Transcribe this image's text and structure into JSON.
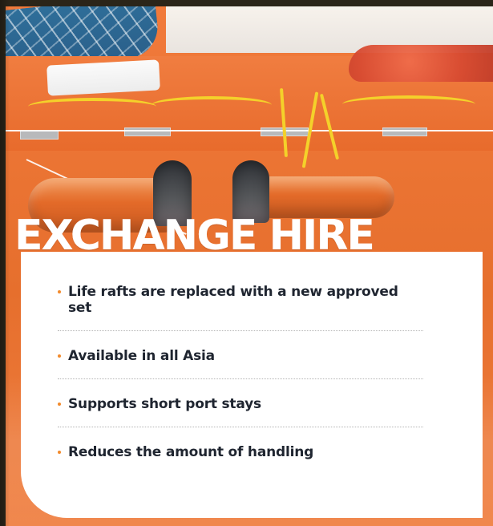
{
  "hero": {
    "headline": "EXCHANGE HIRE"
  },
  "benefits": [
    {
      "text": "Life rafts are replaced with a new approved set"
    },
    {
      "text": "Available in all Asia"
    },
    {
      "text": "Supports short port stays"
    },
    {
      "text": "Reduces the amount of handling"
    }
  ],
  "colors": {
    "accent_orange": "#f28a2c",
    "raft_orange": "#e86b2c",
    "rope_yellow": "#f4d12a",
    "text_dark": "#1f2530",
    "card_white": "#ffffff"
  }
}
